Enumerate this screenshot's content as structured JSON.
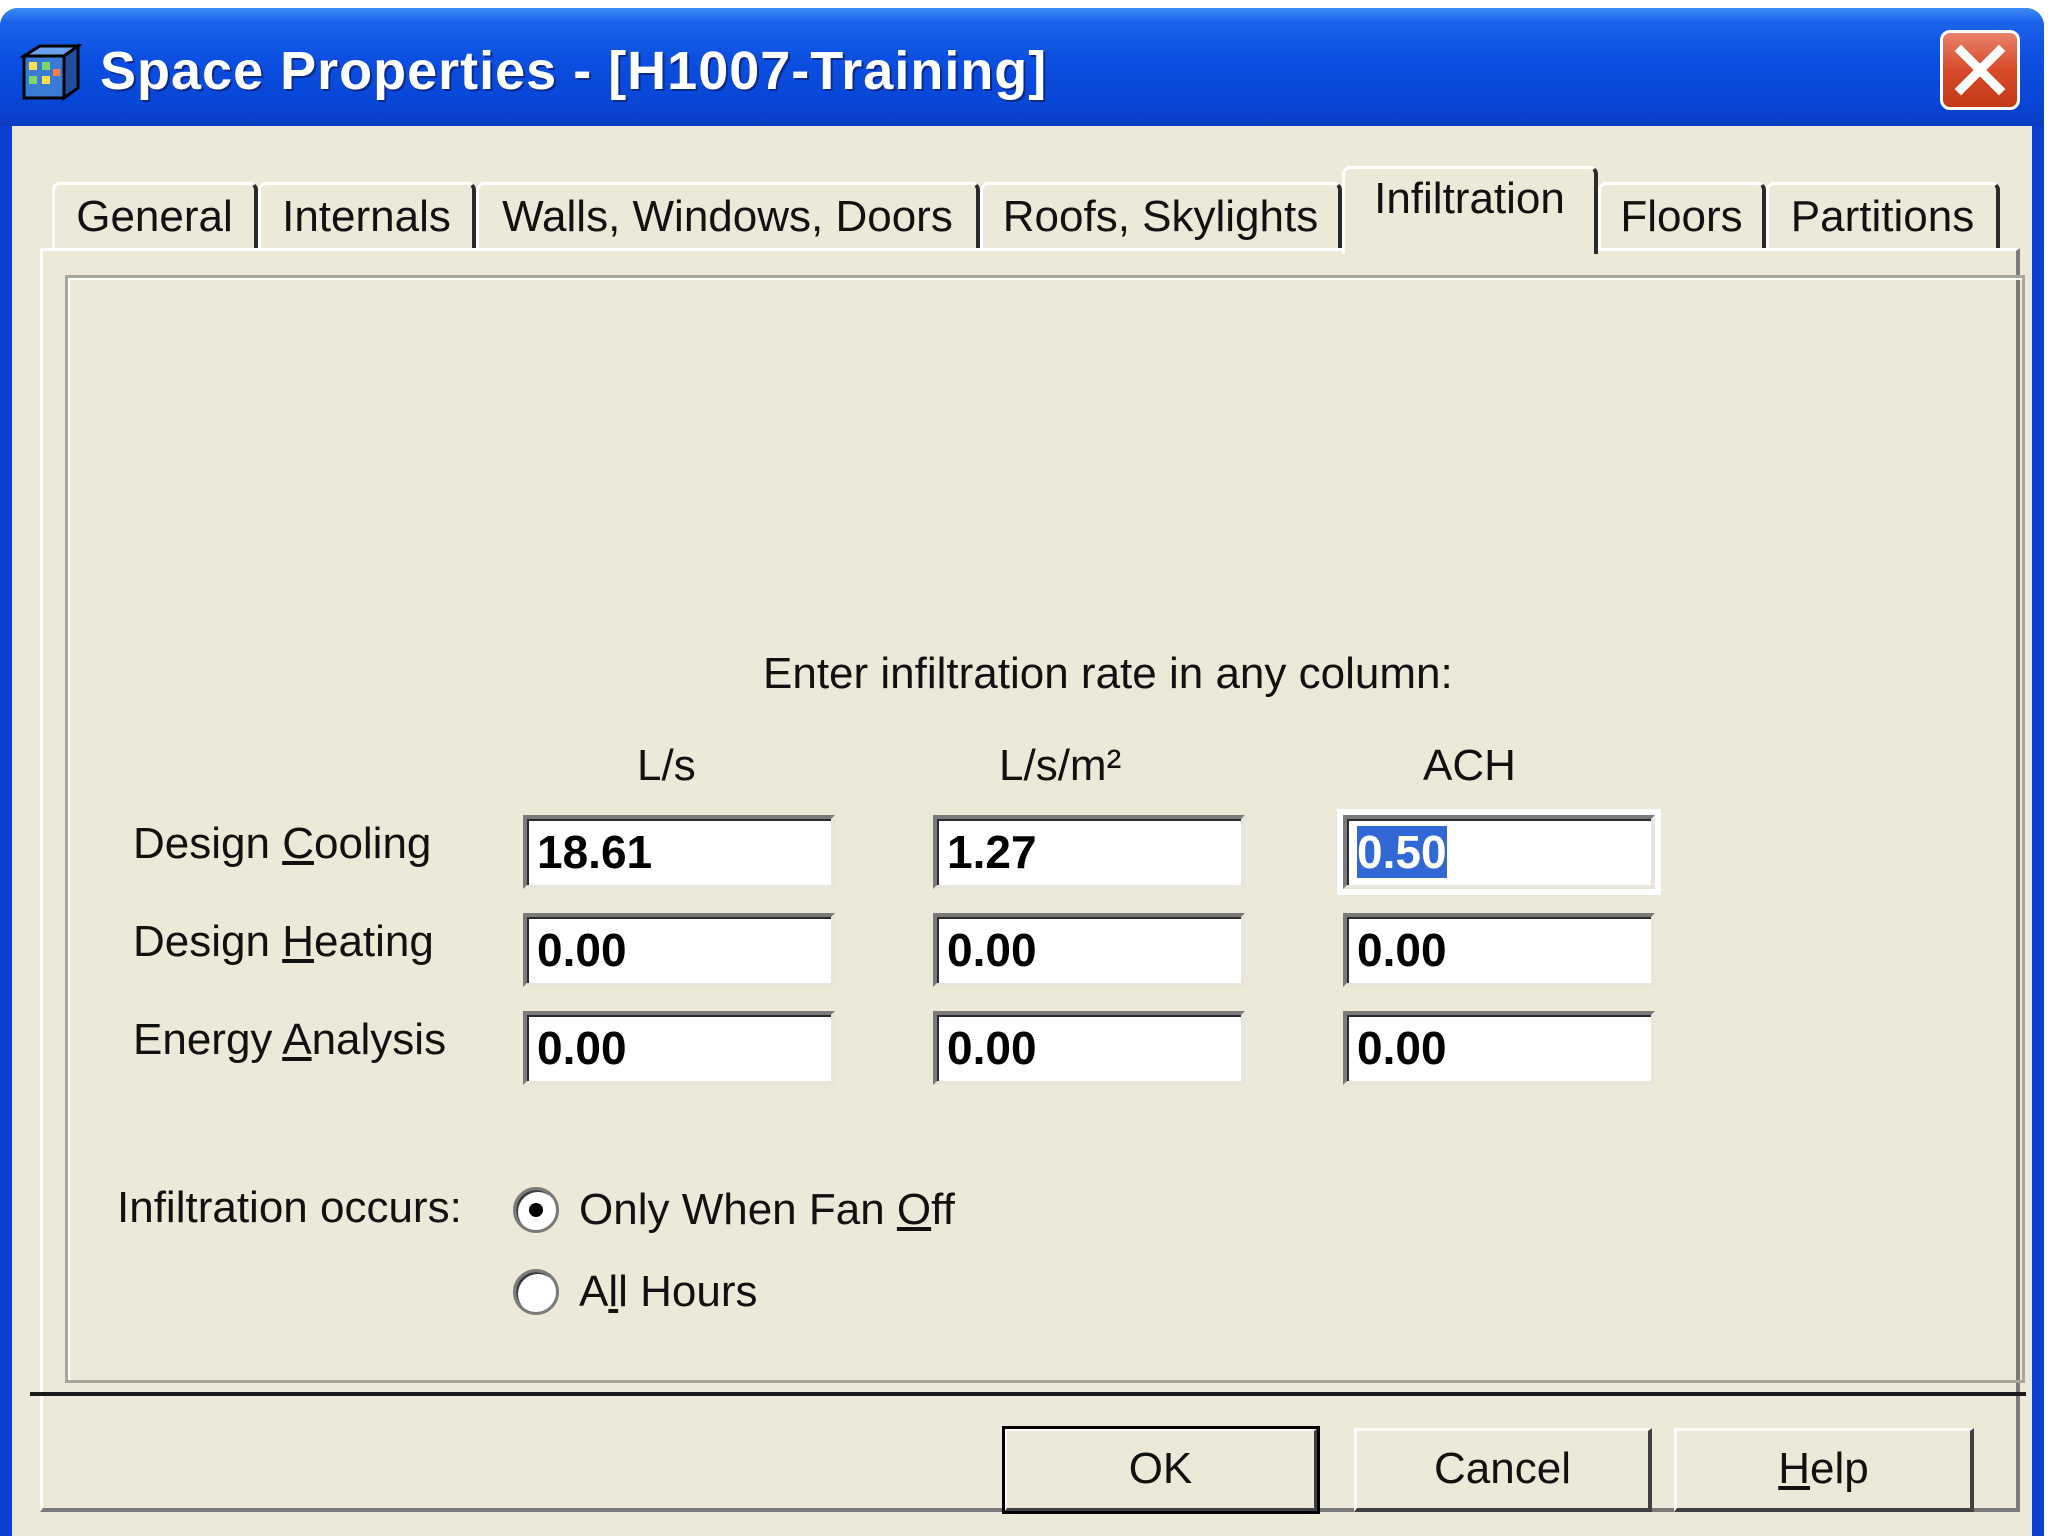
{
  "window": {
    "title": "Space Properties - [H1007-Training]",
    "icon": "building-app-icon",
    "close_icon": "close-x-icon"
  },
  "tabs": [
    {
      "label": "General",
      "active": false
    },
    {
      "label": "Internals",
      "active": false
    },
    {
      "label": "Walls, Windows, Doors",
      "active": false
    },
    {
      "label": "Roofs, Skylights",
      "active": false
    },
    {
      "label": "Infiltration",
      "active": true
    },
    {
      "label": "Floors",
      "active": false
    },
    {
      "label": "Partitions",
      "active": false
    }
  ],
  "infiltration": {
    "instruction": "Enter infiltration rate in any column:",
    "columns": [
      "L/s",
      "L/s/m²",
      "ACH"
    ],
    "rows": [
      {
        "label": "Design Cooling",
        "values": [
          "18.61",
          "1.27",
          "0.50"
        ]
      },
      {
        "label": "Design Heating",
        "values": [
          "0.00",
          "0.00",
          "0.00"
        ]
      },
      {
        "label": "Energy Analysis",
        "values": [
          "0.00",
          "0.00",
          "0.00"
        ]
      }
    ],
    "occurs_label": "Infiltration occurs:",
    "options": [
      {
        "label": "Only When Fan Off",
        "selected": true
      },
      {
        "label": "All Hours",
        "selected": false
      }
    ]
  },
  "buttons": {
    "ok": "OK",
    "cancel": "Cancel",
    "help": "Help"
  },
  "colors": {
    "titlebar": "#0846d6",
    "dialog_bg": "#ece9d8",
    "selection": "#3168d5",
    "close": "#d84a2a"
  }
}
